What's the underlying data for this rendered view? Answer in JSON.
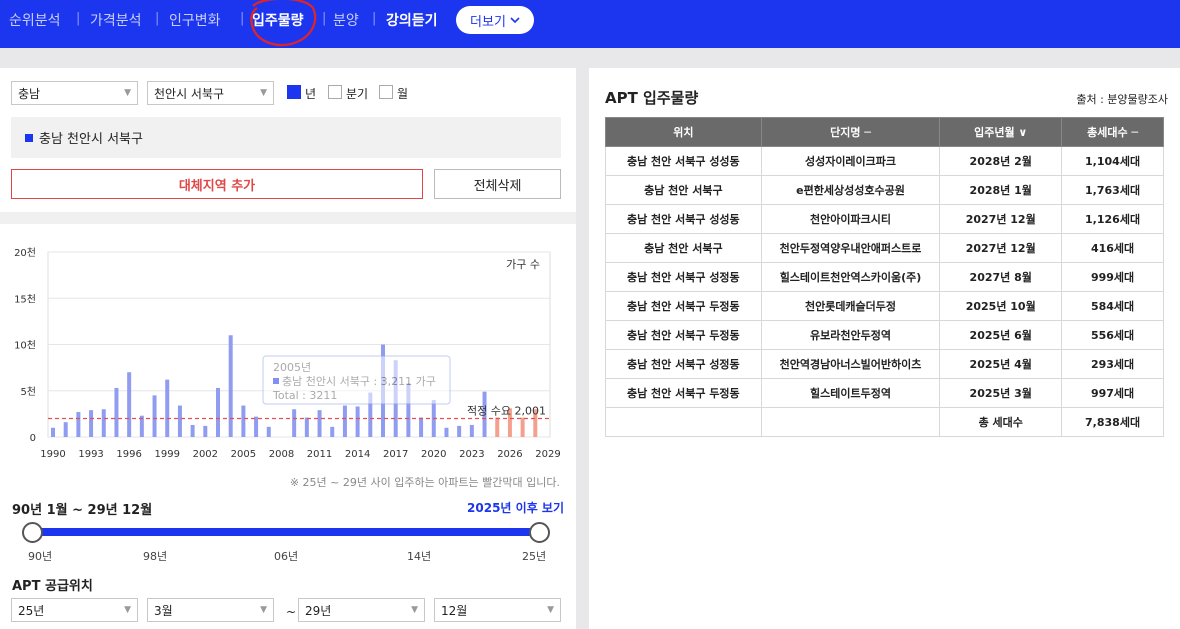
{
  "nav": {
    "items": [
      {
        "label": "순위분석",
        "active": false
      },
      {
        "label": "가격분석",
        "active": false
      },
      {
        "label": "인구변화",
        "active": false
      },
      {
        "label": "입주물량",
        "active": true
      },
      {
        "label": "분양",
        "active": false
      },
      {
        "label": "강의듣기",
        "active": true
      }
    ],
    "more_label": "더보기",
    "more_icon": "chevron-down-icon"
  },
  "filters": {
    "province": "충남",
    "city": "천안시 서북구",
    "period_options": [
      {
        "label": "년",
        "checked": true
      },
      {
        "label": "분기",
        "checked": false
      },
      {
        "label": "월",
        "checked": false
      }
    ]
  },
  "region_selected": "충남 천안시 서북구",
  "buttons": {
    "add_region": "대체지역 추가",
    "delete_all": "전체삭제"
  },
  "chart_data": {
    "type": "bar",
    "legend": "가구 수",
    "ylim": [
      0,
      20000
    ],
    "yticks": [
      "0",
      "5천",
      "10천",
      "15천",
      "20천"
    ],
    "xticks": [
      "1990",
      "1993",
      "1996",
      "1999",
      "2002",
      "2005",
      "2008",
      "2011",
      "2014",
      "2017",
      "2020",
      "2023",
      "2026",
      "2029"
    ],
    "x": [
      1990,
      1991,
      1992,
      1993,
      1994,
      1995,
      1996,
      1997,
      1998,
      1999,
      2000,
      2001,
      2002,
      2003,
      2004,
      2005,
      2006,
      2007,
      2008,
      2009,
      2010,
      2011,
      2012,
      2013,
      2014,
      2015,
      2016,
      2017,
      2018,
      2019,
      2020,
      2021,
      2022,
      2023,
      2024,
      2025,
      2026,
      2027,
      2028
    ],
    "values": [
      1000,
      1600,
      2700,
      2900,
      3000,
      5300,
      7000,
      2300,
      4500,
      6200,
      3400,
      1300,
      1200,
      5300,
      11000,
      3400,
      2200,
      1100,
      0,
      3000,
      2100,
      2900,
      1100,
      3400,
      3300,
      4800,
      10000,
      8300,
      5800,
      2100,
      4000,
      1000,
      1200,
      1300,
      4900,
      2100,
      3100,
      2100,
      3000
    ],
    "forecast_from": 2025,
    "demand_label": "적정 수요 2,001",
    "demand_value": 2001,
    "tooltip": {
      "year": "2005년",
      "region_line": "충남 천안시 서북구 : 3,211 가구",
      "total": "Total : 3211"
    },
    "colors": {
      "past": "#8f9cf0",
      "future": "#f4a08f",
      "demand": "#e45050"
    }
  },
  "chart_note": "※ 25년 ~ 29년 사이 입주하는 아파트는 빨간막대 입니다.",
  "range": {
    "title": "90년 1월 ~ 29년 12월",
    "link": "2025년 이후 보기",
    "labels": [
      "90년",
      "98년",
      "06년",
      "14년",
      "25년"
    ]
  },
  "supply": {
    "title": "APT 공급위치",
    "from_year": "25년",
    "from_month": "3월",
    "separator": "~",
    "to_year": "29년",
    "to_month": "12월"
  },
  "table": {
    "title": "APT 입주물량",
    "source": "출처 : 분양물량조사",
    "headers": [
      "위치",
      "단지명 ─",
      "입주년월 ∨",
      "총세대수 ─"
    ],
    "rows": [
      [
        "충남 천안 서북구 성성동",
        "성성자이레이크파크",
        "2028년 2월",
        "1,104세대"
      ],
      [
        "충남 천안 서북구",
        "e편한세상성성호수공원",
        "2028년 1월",
        "1,763세대"
      ],
      [
        "충남 천안 서북구 성성동",
        "천안아이파크시티",
        "2027년 12월",
        "1,126세대"
      ],
      [
        "충남 천안 서북구",
        "천안두정역양우내안애퍼스트로",
        "2027년 12월",
        "416세대"
      ],
      [
        "충남 천안 서북구 성정동",
        "힐스테이트천안역스카이움(주)",
        "2027년 8월",
        "999세대"
      ],
      [
        "충남 천안 서북구 두정동",
        "천안롯데캐슬더두정",
        "2025년 10월",
        "584세대"
      ],
      [
        "충남 천안 서북구 두정동",
        "유보라천안두정역",
        "2025년 6월",
        "556세대"
      ],
      [
        "충남 천안 서북구 성정동",
        "천안역경남아너스빌어반하이츠",
        "2025년 4월",
        "293세대"
      ],
      [
        "충남 천안 서북구 두정동",
        "힐스테이트두정역",
        "2025년 3월",
        "997세대"
      ]
    ],
    "total_label": "총 세대수",
    "total_value": "7,838세대"
  }
}
